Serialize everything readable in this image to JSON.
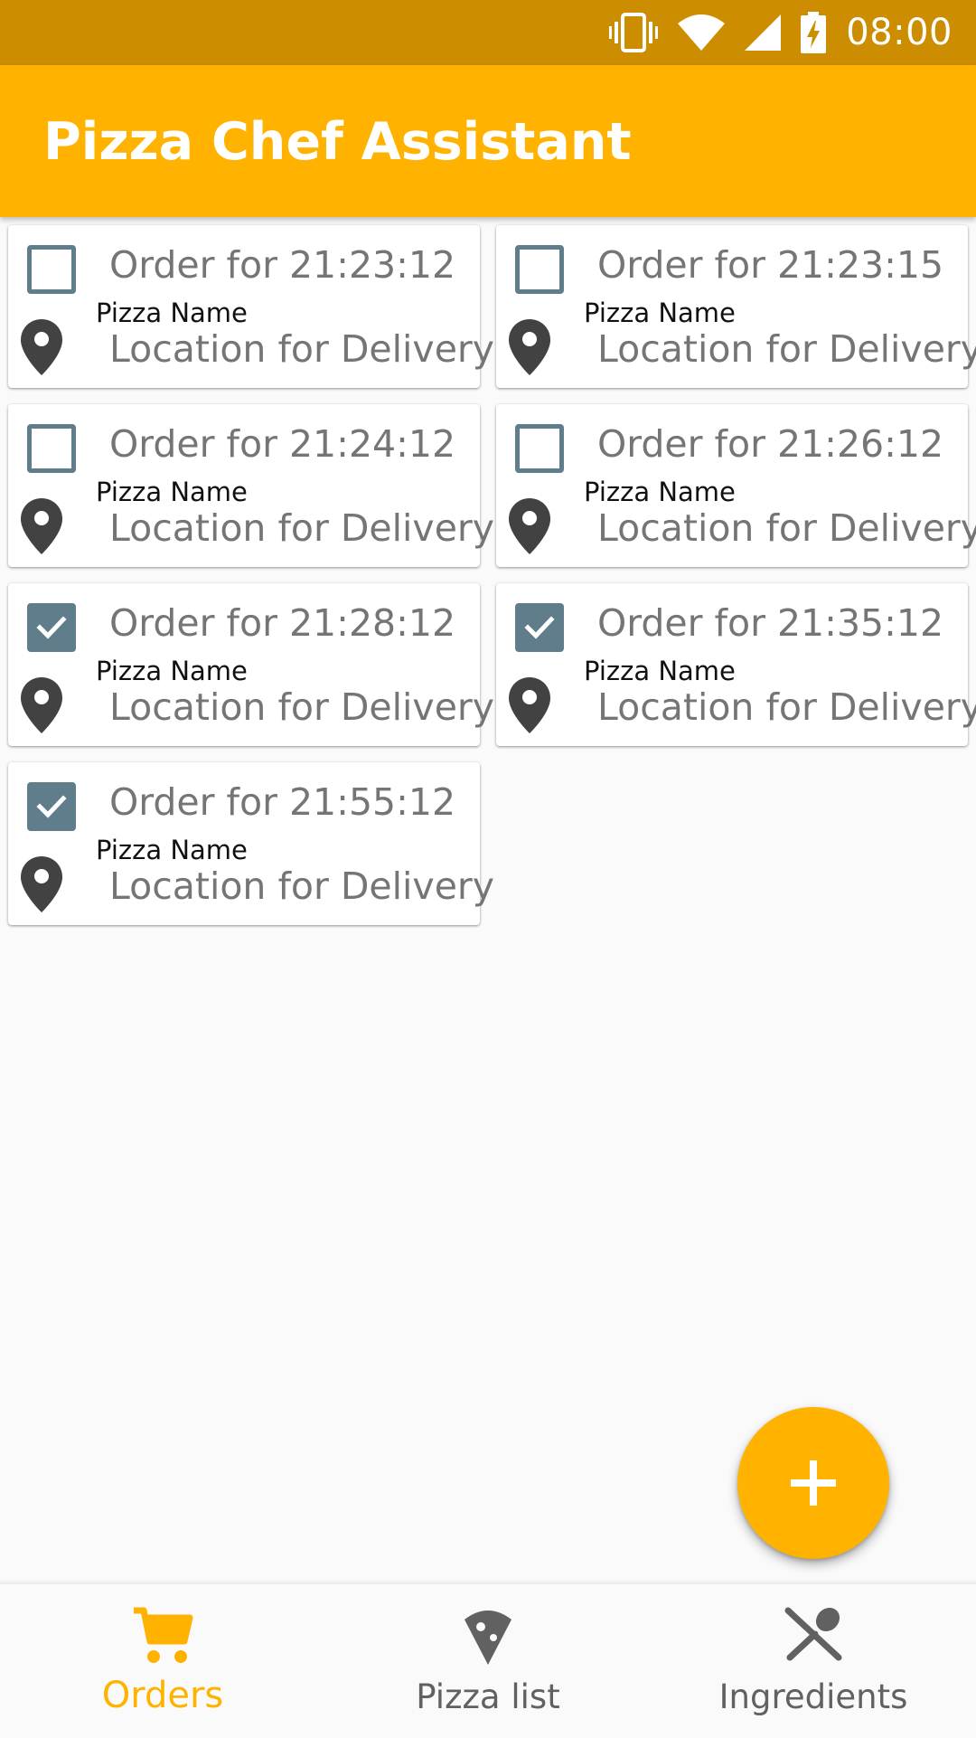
{
  "status_bar": {
    "time": "08:00",
    "icons": [
      "vibrate-icon",
      "wifi-icon",
      "cell-signal-icon",
      "battery-charging-icon"
    ]
  },
  "app_bar": {
    "title": "Pizza Chef Assistant"
  },
  "orders": [
    {
      "time_label": "Order for 21:23:12",
      "pizza_name": "Pizza Name",
      "location": "Location for Delivery",
      "checked": false
    },
    {
      "time_label": "Order for 21:23:15",
      "pizza_name": "Pizza Name",
      "location": "Location for Delivery",
      "checked": false
    },
    {
      "time_label": "Order for 21:24:12",
      "pizza_name": "Pizza Name",
      "location": "Location for Delivery",
      "checked": false
    },
    {
      "time_label": "Order for 21:26:12",
      "pizza_name": "Pizza Name",
      "location": "Location for Delivery",
      "checked": false
    },
    {
      "time_label": "Order for 21:28:12",
      "pizza_name": "Pizza Name",
      "location": "Location for Delivery",
      "checked": true
    },
    {
      "time_label": "Order for 21:35:12",
      "pizza_name": "Pizza Name",
      "location": "Location for Delivery",
      "checked": true
    },
    {
      "time_label": "Order for 21:55:12",
      "pizza_name": "Pizza Name",
      "location": "Location for Delivery",
      "checked": true
    }
  ],
  "fab": {
    "icon": "plus-icon"
  },
  "bottom_nav": {
    "items": [
      {
        "label": "Orders",
        "icon": "cart-icon",
        "active": true
      },
      {
        "label": "Pizza list",
        "icon": "pizza-slice-icon",
        "active": false
      },
      {
        "label": "Ingredients",
        "icon": "utensils-icon",
        "active": false
      }
    ]
  },
  "colors": {
    "status_bar": "#cc8e00",
    "primary": "#ffb300",
    "checkbox": "#607d8b",
    "secondary_text": "#757575",
    "icon_dark": "#424242",
    "nav_inactive": "#616161",
    "background": "#fafafa"
  }
}
